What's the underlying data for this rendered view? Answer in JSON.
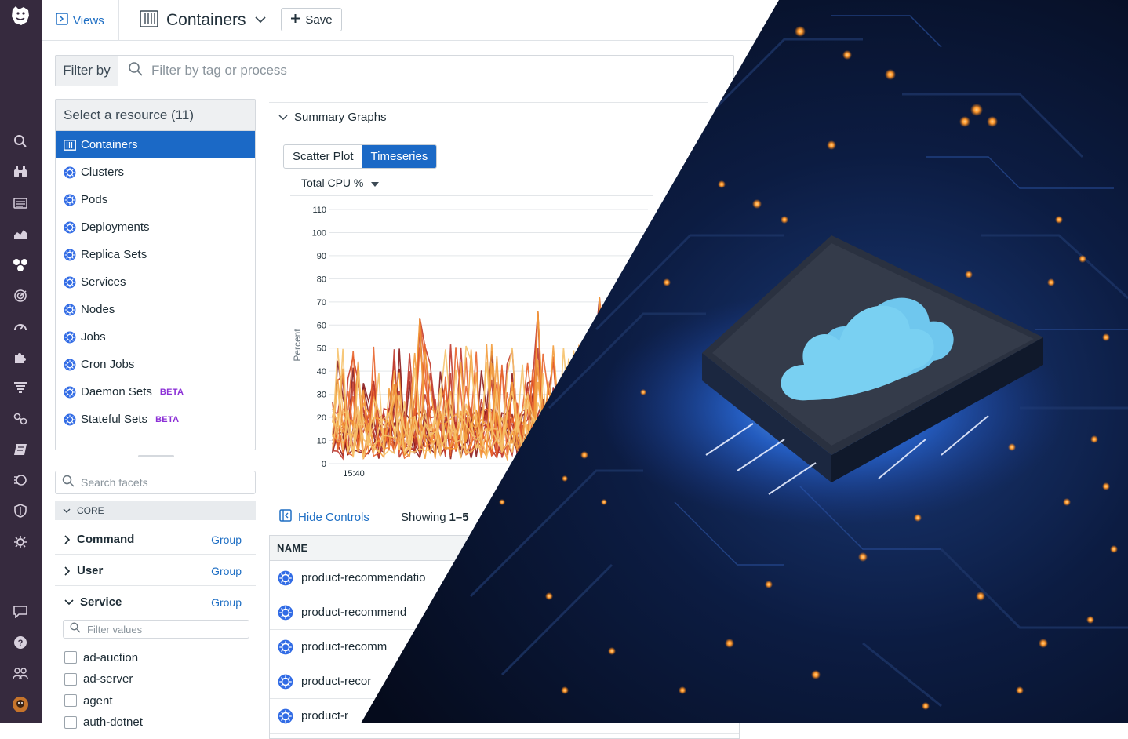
{
  "header": {
    "views_label": "Views",
    "title": "Containers",
    "save_label": "Save"
  },
  "filter": {
    "label": "Filter by",
    "placeholder": "Filter by tag or process"
  },
  "resources": {
    "heading": "Select a resource (11)",
    "items": [
      {
        "label": "Containers",
        "beta": ""
      },
      {
        "label": "Clusters",
        "beta": ""
      },
      {
        "label": "Pods",
        "beta": ""
      },
      {
        "label": "Deployments",
        "beta": ""
      },
      {
        "label": "Replica Sets",
        "beta": ""
      },
      {
        "label": "Services",
        "beta": ""
      },
      {
        "label": "Nodes",
        "beta": ""
      },
      {
        "label": "Jobs",
        "beta": ""
      },
      {
        "label": "Cron Jobs",
        "beta": ""
      },
      {
        "label": "Daemon Sets",
        "beta": "BETA"
      },
      {
        "label": "Stateful Sets",
        "beta": "BETA"
      }
    ]
  },
  "facets": {
    "search_placeholder": "Search facets",
    "core_label": "CORE",
    "group_label": "Group",
    "items": [
      {
        "label": "Command",
        "expanded": false
      },
      {
        "label": "User",
        "expanded": false
      },
      {
        "label": "Service",
        "expanded": true
      }
    ],
    "filter_values_placeholder": "Filter values",
    "service_values": [
      "ad-auction",
      "ad-server",
      "agent",
      "auth-dotnet"
    ]
  },
  "summary": {
    "heading": "Summary Graphs",
    "tabs": [
      "Scatter Plot",
      "Timeseries"
    ],
    "active_tab": "Timeseries",
    "metric": "Total CPU %"
  },
  "chart_data": {
    "type": "line",
    "ylabel": "Percent",
    "xlabel": "",
    "x_tick_labels": [
      "15:40"
    ],
    "y_ticks": [
      0,
      10,
      20,
      30,
      40,
      50,
      60,
      70,
      80,
      90,
      100,
      110
    ],
    "ylim": [
      0,
      110
    ],
    "grid": true,
    "colors": [
      "#8b1a1a",
      "#c0392b",
      "#e8632b",
      "#f39c3c",
      "#f6c26b"
    ],
    "peaks": [
      {
        "x_index": 17,
        "value": 63
      },
      {
        "x_index": 40,
        "value": 66
      },
      {
        "x_index": 52,
        "value": 72
      }
    ]
  },
  "table": {
    "hide_controls": "Hide Controls",
    "showing_prefix": "Showing",
    "showing_range": "1–5",
    "column_name": "NAME",
    "rows": [
      "product-recommendatio",
      "product-recommend",
      "product-recomm",
      "product-recor",
      "product-r"
    ]
  },
  "colors": {
    "nav_bg": "#362a3e",
    "accent": "#1b69c6",
    "beta": "#8b2fd6"
  }
}
